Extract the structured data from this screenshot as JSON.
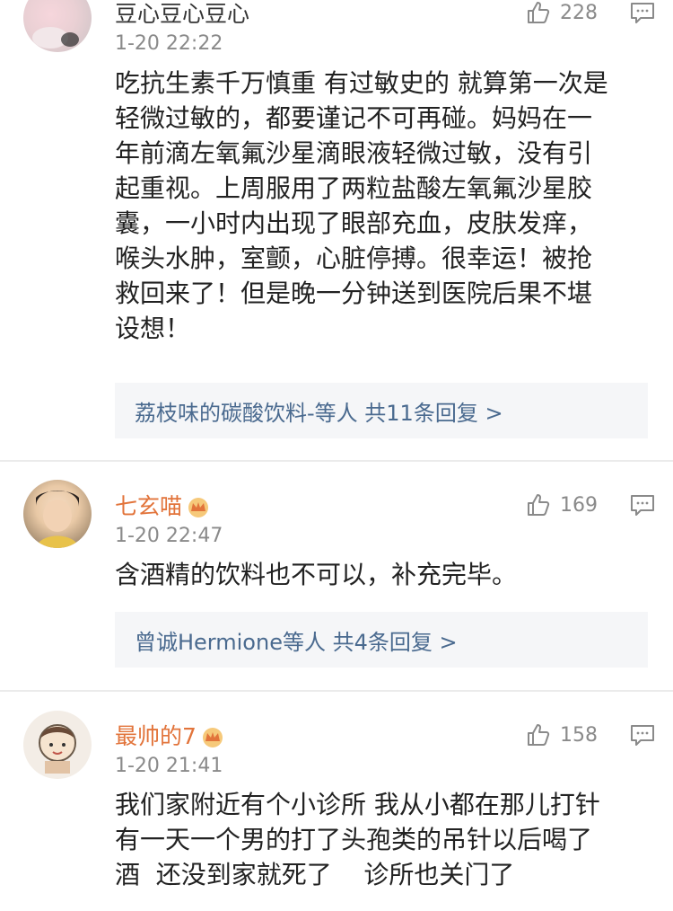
{
  "comments": [
    {
      "username": "豆心豆心豆心",
      "time": "1-20 22:22",
      "likes": "228",
      "lines": [
        "吃抗生素千万慎重 有过敏史的 就算第一次是",
        "轻微过敏的，都要谨记不可再碰。妈妈在一",
        "年前滴左氧氟沙星滴眼液轻微过敏，没有引",
        "起重视。上周服用了两粒盐酸左氧氟沙星胶",
        "囊，一小时内出现了眼部充血，皮肤发痒，",
        "喉头水肿，室颤，心脏停搏。很幸运！被抢",
        "救回来了！但是晚一分钟送到医院后果不堪",
        "设想！"
      ],
      "replies": "荔枝味的碳酸饮料-等人  共11条回复 >"
    },
    {
      "username": "七玄喵",
      "time": "1-20 22:47",
      "likes": "169",
      "lines": [
        "含酒精的饮料也不可以，补充完毕。"
      ],
      "replies": "曾诚Hermione等人  共4条回复 >"
    },
    {
      "username": "最帅的7",
      "time": "1-20 21:41",
      "likes": "158",
      "lines": [
        "我们家附近有个小诊所  我从小都在那儿打针",
        "有一天一个男的打了头孢类的吊针以后喝了",
        "酒  还没到家就死了    诊所也关门了"
      ]
    }
  ],
  "colors": {
    "vip_username": "#e2743b",
    "normal_username": "#333333",
    "meta": "#8a8a8a",
    "reply_link": "#4a6a8f"
  },
  "icons": [
    "like-icon",
    "comment-icon",
    "crown-badge-icon"
  ]
}
